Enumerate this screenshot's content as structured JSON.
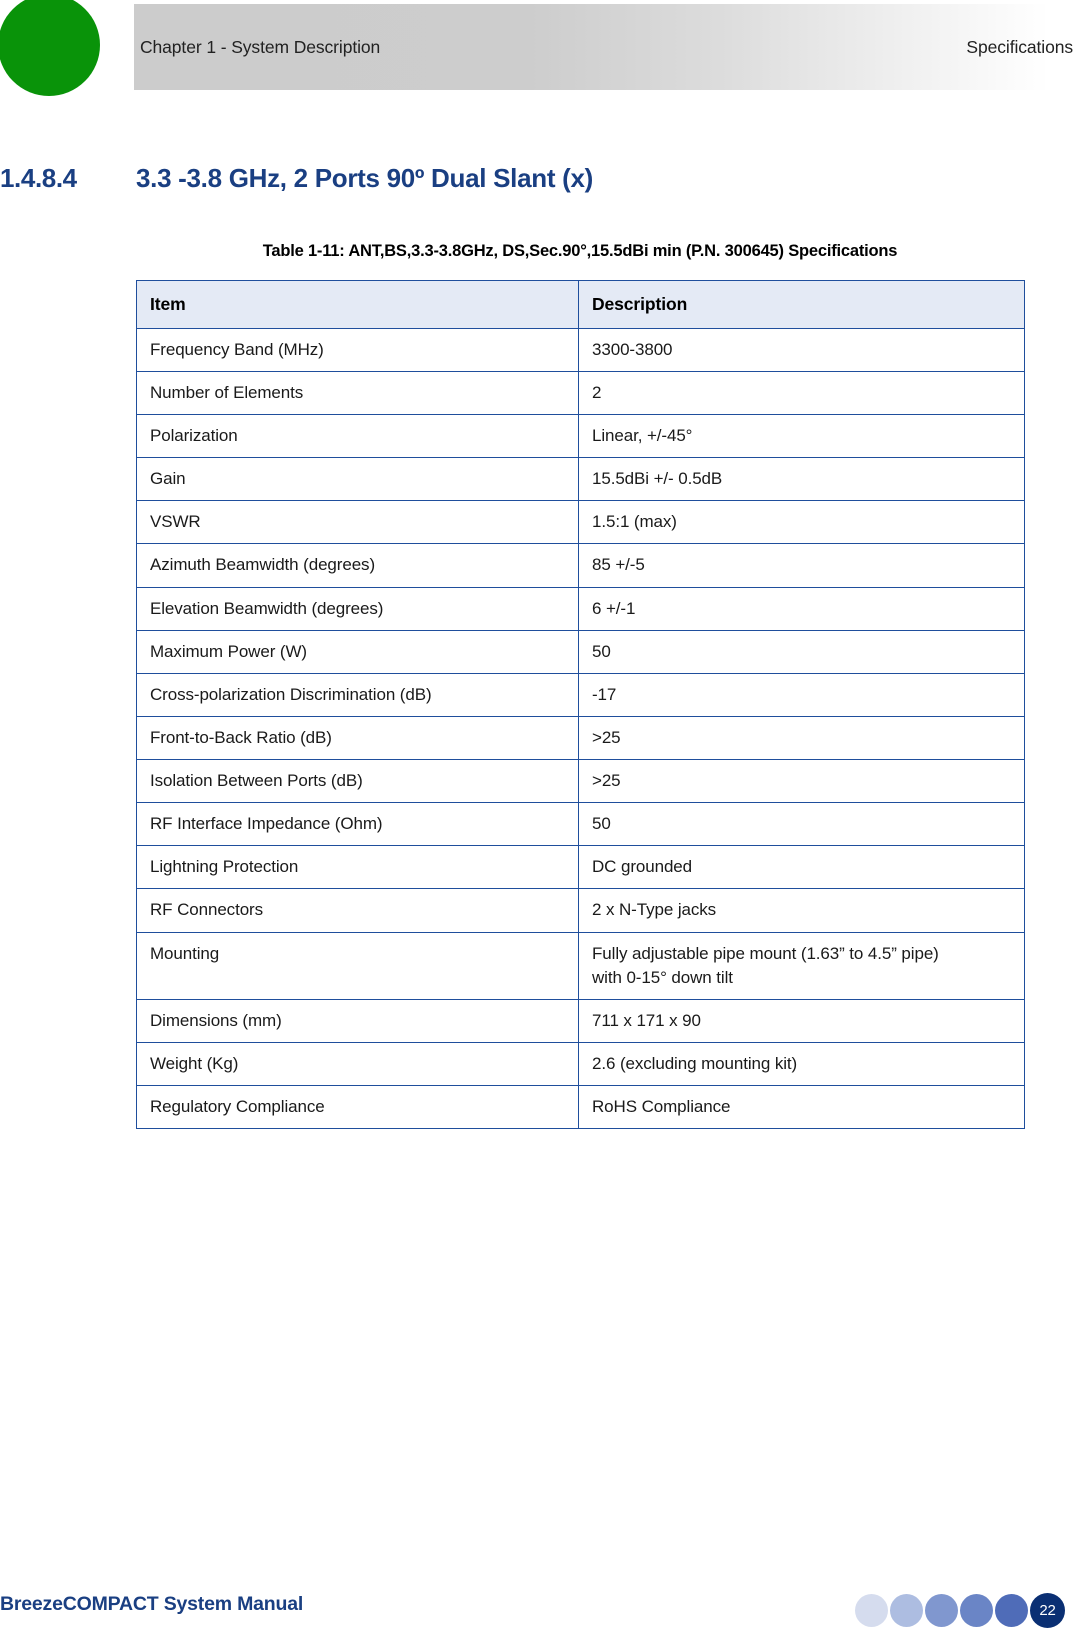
{
  "header": {
    "chapter": "Chapter 1 - System Description",
    "section": "Specifications",
    "dot_color": "#099309",
    "band_start_color": "#cccccc",
    "band_end_color": "#ffffff"
  },
  "heading": {
    "number": "1.4.8.4",
    "title": "3.3 -3.8 GHz, 2 Ports 90º Dual Slant (x)",
    "color": "#1a3f82"
  },
  "table": {
    "caption": "Table 1-11: ANT,BS,3.3-3.8GHz, DS,Sec.90°,15.5dBi min (P.N. 300645) Specifications",
    "border_color": "#1f4e9c",
    "header_bg_color": "#e4eaf5",
    "columns": [
      "Item",
      "Description"
    ],
    "rows": [
      {
        "item": "Frequency Band (MHz)",
        "description": "3300-3800"
      },
      {
        "item": "Number of Elements",
        "description": "2"
      },
      {
        "item": "Polarization",
        "description": "Linear, +/-45°"
      },
      {
        "item": "Gain",
        "description": "15.5dBi +/- 0.5dB"
      },
      {
        "item": "VSWR",
        "description": "1.5:1 (max)"
      },
      {
        "item": "Azimuth Beamwidth (degrees)",
        "description": "85 +/-5"
      },
      {
        "item": "Elevation Beamwidth (degrees)",
        "description": "6 +/-1"
      },
      {
        "item": "Maximum Power (W)",
        "description": "50"
      },
      {
        "item": "Cross-polarization Discrimination (dB)",
        "description": "-17"
      },
      {
        "item": "Front-to-Back Ratio (dB)",
        "description": ">25"
      },
      {
        "item": "Isolation Between Ports (dB)",
        "description": ">25"
      },
      {
        "item": "RF Interface Impedance (Ohm)",
        "description": "50"
      },
      {
        "item": "Lightning Protection",
        "description": "DC grounded"
      },
      {
        "item": "RF Connectors",
        "description": "2 x N-Type jacks"
      },
      {
        "item": "Mounting",
        "description": "Fully adjustable pipe mount (1.63” to 4.5” pipe)\nwith 0-15° down tilt"
      },
      {
        "item": "Dimensions (mm)",
        "description": "711 x 171 x 90"
      },
      {
        "item": "Weight (Kg)",
        "description": "2.6 (excluding mounting kit)"
      },
      {
        "item": "Regulatory Compliance",
        "description": "RoHS Compliance"
      }
    ]
  },
  "footer": {
    "title": "BreezeCOMPACT System Manual",
    "title_color": "#1a3f82",
    "page_number": "22",
    "page_dot_color": "#0a2f73",
    "dot_colors": [
      "#d5dcee",
      "#adbde1",
      "#8097cf",
      "#6a85c6",
      "#4f6cb8"
    ]
  }
}
